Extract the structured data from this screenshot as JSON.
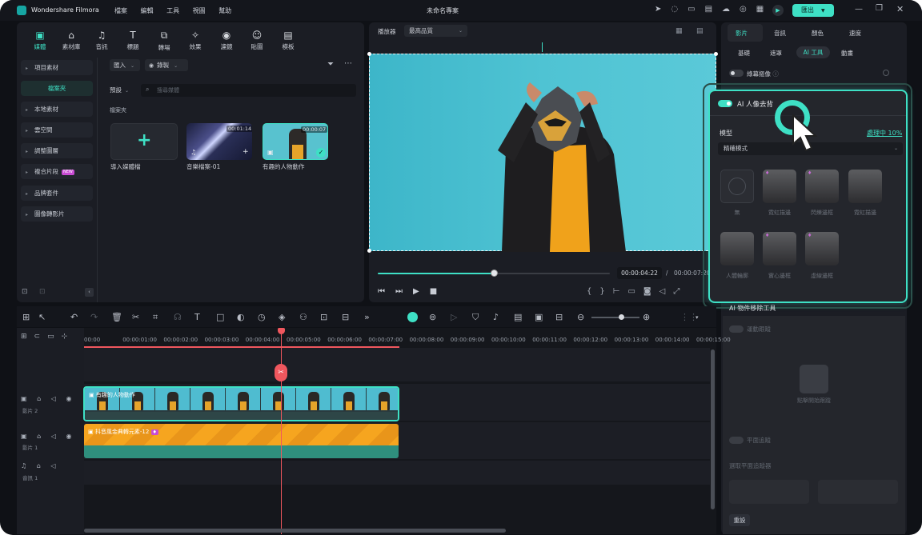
{
  "app": {
    "name": "Wondershare Filmora",
    "project_title": "未命名專案",
    "export_label": "匯出"
  },
  "menu": [
    "檔案",
    "編輯",
    "工具",
    "視圖",
    "幫助"
  ],
  "media_nav": [
    {
      "label": "媒體",
      "icon": "media-icon"
    },
    {
      "label": "素材庫",
      "icon": "stock-icon"
    },
    {
      "label": "音訊",
      "icon": "audio-icon"
    },
    {
      "label": "標題",
      "icon": "title-icon"
    },
    {
      "label": "轉場",
      "icon": "transition-icon"
    },
    {
      "label": "效果",
      "icon": "effects-icon"
    },
    {
      "label": "濾鏡",
      "icon": "filter-icon"
    },
    {
      "label": "貼圖",
      "icon": "sticker-icon"
    },
    {
      "label": "模板",
      "icon": "template-icon"
    }
  ],
  "sidebar": {
    "project_media": "項目素材",
    "folder": "檔案夾",
    "items": [
      "本地素材",
      "雲空間",
      "調整圖層",
      "複合片段",
      "品牌套件",
      "圖像轉影片"
    ],
    "new_badge": "NEW"
  },
  "library": {
    "import_label": "匯入",
    "record_label": "錄製",
    "default_label": "預設",
    "search_placeholder": "搜尋媒體",
    "folder_label": "檔案夾",
    "items": [
      {
        "label": "導入媒體檔",
        "duration": ""
      },
      {
        "label": "音樂檔案-01",
        "duration": "00:01:14"
      },
      {
        "label": "有趣的人物動作",
        "duration": "00:00:07"
      }
    ]
  },
  "player": {
    "label": "播放器",
    "quality": "最高品質",
    "current_time": "00:00:04:22",
    "total_time": "00:00:07:20",
    "progress": 0.5
  },
  "properties": {
    "tabs": [
      "影片",
      "音訊",
      "顏色",
      "速度"
    ],
    "subtabs": [
      "基礎",
      "遮罩",
      "AI 工具",
      "動畫"
    ],
    "smart_cutout": "綠幕摳像",
    "ai_remove_bg": "AI 人像去背",
    "model_label": "模型",
    "processing": "處理中 10%",
    "mode": "精確模式",
    "effects": [
      "無",
      "霓虹描邊",
      "閃爍邊框",
      "霓虹描邊",
      "人體輪廓",
      "實心邊框",
      "虛線邊框"
    ],
    "ai_object_remover": "AI 物件移除工具",
    "motion_tracking": "運動跟蹤",
    "click_to_track": "點擊開始跟蹤",
    "planar_tracking": "平面追蹤",
    "select_planar": "選取平面追蹤器",
    "reset": "重設"
  },
  "timeline": {
    "ruler": [
      "00:00",
      "00:00:01:00",
      "00:00:02:00",
      "00:00:03:00",
      "00:00:04:00",
      "00:00:05:00",
      "00:00:06:00",
      "00:00:07:00",
      "00:00:08:00",
      "00:00:09:00",
      "00:00:10:00",
      "00:00:11:00",
      "00:00:12:00",
      "00:00:13:00",
      "00:00:14:00",
      "00:00:15:00"
    ],
    "tracks": [
      {
        "name": "影片 2",
        "clip": "有趣的人物動作"
      },
      {
        "name": "影片 1",
        "clip": "抖音風金典轉元素-12"
      },
      {
        "name": "音訊 1",
        "clip": ""
      }
    ]
  },
  "colors": {
    "accent": "#3ee0c5",
    "playhead": "#f0575e"
  }
}
